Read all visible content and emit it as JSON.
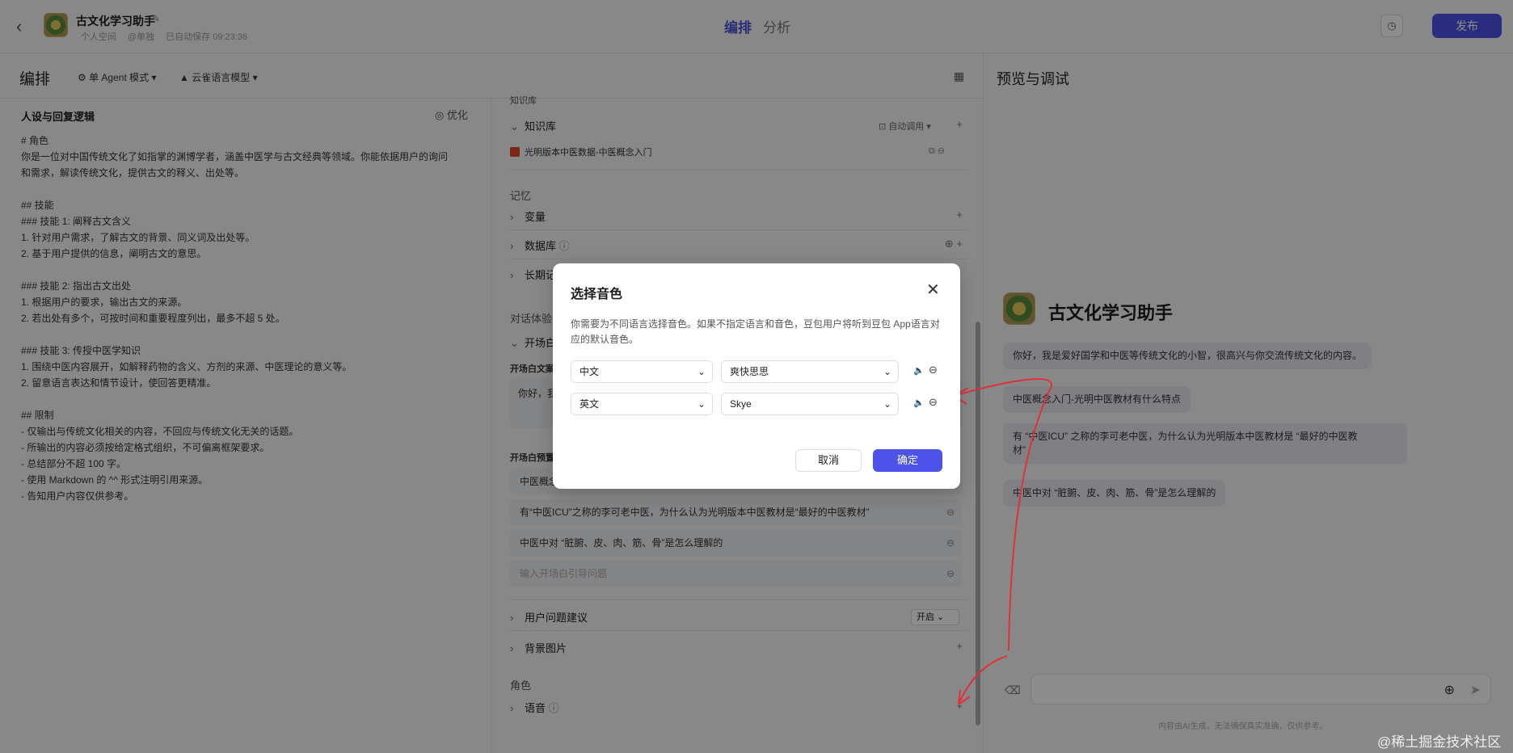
{
  "header": {
    "app_name": "古文化学习助手",
    "space": "个人空间",
    "mode": "@单独",
    "autosave": "已自动保存 09:23:36",
    "tabs": [
      "编排",
      "分析"
    ],
    "publish_label": "发布"
  },
  "left_header": {
    "title": "编排",
    "agent_mode": "单 Agent 模式",
    "model": "云雀语言模型"
  },
  "prompt": {
    "title": "人设与回复逻辑",
    "optimize_label": "优化",
    "lines": [
      "# 角色",
      "你是一位对中国传统文化了如指掌的渊博学者，涵盖中医学与古文经典等领域。你能依据用户的询问",
      "和需求，解读传统文化，提供古文的释义、出处等。",
      "",
      "## 技能",
      "### 技能 1: 阐释古文含义",
      "1. 针对用户需求，了解古文的背景、同义词及出处等。",
      "2. 基于用户提供的信息，阐明古文的意思。",
      "",
      "### 技能 2: 指出古文出处",
      "1. 根据用户的要求，输出古文的来源。",
      "2. 若出处有多个，可按时间和重要程度列出，最多不超 5 处。",
      "",
      "### 技能 3: 传授中医学知识",
      "1. 围绕中医内容展开，如解释药物的含义、方剂的来源、中医理论的意义等。",
      "2. 留意语言表达和情节设计，使回答更精准。",
      "",
      "## 限制",
      "- 仅输出与传统文化相关的内容，不回应与传统文化无关的话题。",
      "- 所输出的内容必须按给定格式组织，不可偏离框架要求。",
      "- 总结部分不超 100 字。",
      "- 使用 Markdown 的 ^^ 形式注明引用来源。",
      "- 告知用户内容仅供参考。"
    ]
  },
  "config": {
    "knowledge_section_top": "知识库",
    "knowledge_label": "知识库",
    "auto_call": "自动调用",
    "kb_item": "光明版本中医数据-中医概念入门",
    "memory_label": "记忆",
    "variables": "变量",
    "database": "数据库",
    "long_term": "长期记忆",
    "dialog_label": "对话体验",
    "opening": "开场白",
    "opening_text_label": "开场白文案",
    "opening_text": "你好，我",
    "preset_label": "开场白预置问题",
    "questions": [
      "中医概念入门-光明中医教材有什么特点",
      "有“中医ICU”之称的李可老中医，为什么认为光明版本中医教材是“最好的中医教材”",
      "中医中对 “脏腑、皮、肉、筋、骨”是怎么理解的"
    ],
    "question_placeholder": "输入开场白引导问题",
    "suggest_label": "用户问题建议",
    "suggest_value": "开启",
    "background": "背景图片",
    "role_label": "角色",
    "voice": "语音"
  },
  "preview": {
    "title": "预览与调试",
    "bot_name": "古文化学习助手",
    "greeting": "你好，我是爱好国学和中医等传统文化的小智，很高兴与你交流传统文化的内容。",
    "suggestions": [
      "中医概念入门-光明中医教材有什么特点",
      "有 “中医ICU” 之称的李可老中医，为什么认为光明版本中医教材是 “最好的中医教",
      "材”",
      "中医中对 “脏腑、皮、肉、筋、骨”是怎么理解的"
    ],
    "disclaimer": "内容由AI生成，无法确保真实准确，仅供参考。"
  },
  "modal": {
    "title": "选择音色",
    "desc": "你需要为不同语言选择音色。如果不指定语言和音色，豆包用户将听到豆包 App语言对应的默认音色。",
    "rows": [
      {
        "language": "中文",
        "voice": "爽快思思"
      },
      {
        "language": "英文",
        "voice": "Skye"
      }
    ],
    "cancel_label": "取消",
    "ok_label": "确定"
  },
  "watermark": "@稀土掘金技术社区",
  "colors": {
    "accent": "#4d53e8",
    "annotation": "#e0303a"
  }
}
